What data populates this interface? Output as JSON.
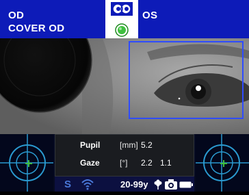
{
  "header": {
    "eye": "OD",
    "mode": "COVER OD",
    "other_eye": "OS",
    "indicator_color": "#3fbf3f",
    "bar_color": "#0d1bb8",
    "icons": [
      "binocular-eyes-icon",
      "status-indicator-dot"
    ]
  },
  "camera": {
    "roi_color": "#2f4cff",
    "occluder_color": "#050505"
  },
  "readouts": [
    {
      "label": "Pupil",
      "unit": "[mm]",
      "values": [
        "5.2"
      ]
    },
    {
      "label": "Gaze",
      "unit": "[°]",
      "values": [
        "2.2",
        "1.1"
      ]
    }
  ],
  "status": {
    "mode_letter": "S",
    "age_range": "20-99y",
    "accent_color": "#4a78d8",
    "icons": [
      "wifi-icon",
      "flower-icon",
      "camera-icon",
      "battery-icon"
    ]
  },
  "targets": {
    "crosshair_color": "#2a9ad0",
    "marker_color": "#3fbf3f",
    "icons": [
      "target-crosshair-icon"
    ]
  }
}
